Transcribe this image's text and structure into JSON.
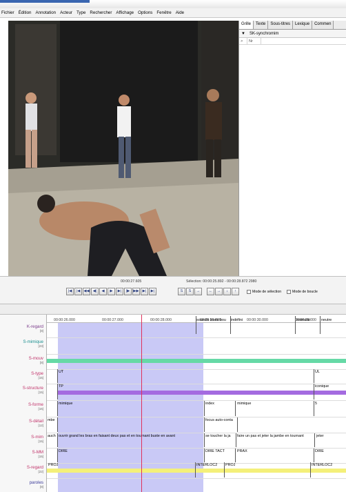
{
  "menu": [
    "Fichier",
    "Édition",
    "Annotation",
    "Acteur",
    "Type",
    "Rechercher",
    "Affichage",
    "Options",
    "Fenêtre",
    "Aide"
  ],
  "right_panel": {
    "tabs": [
      "Grille",
      "Texte",
      "Sous-titres",
      "Lexique",
      "Commen"
    ],
    "tier_dropdown": "SK-synchromim",
    "column_header": "Nr"
  },
  "controls": {
    "current_time": "00:00:27.605",
    "selection": "Sélection: 00:00:25.892 - 00:00:28.872 2980",
    "selection_mode": "Mode de sélection",
    "loop_mode": "Mode de boucle"
  },
  "timeline": {
    "ticks": [
      "00:00:26.000",
      "00:00:27.000",
      "00:00:28.000",
      "00:00:29.000",
      "00:00:30.000",
      "00:00:31.000"
    ]
  },
  "tiers": [
    {
      "name": "K-regard",
      "count": "[8]",
      "color": "#7a3a8a"
    },
    {
      "name": "S-mimique",
      "count": "[23]",
      "color": "#1a8f8f"
    },
    {
      "name": "S-mouv",
      "count": "[8]",
      "color": "#c0336a"
    },
    {
      "name": "S-type",
      "count": "[15]",
      "color": "#c0336a"
    },
    {
      "name": "S-structure",
      "count": "[15]",
      "color": "#c0336a"
    },
    {
      "name": "S-forme",
      "count": "[16]",
      "color": "#c0336a"
    },
    {
      "name": "S-détail",
      "count": "[12]",
      "color": "#c0336a"
    },
    {
      "name": "S-mim",
      "count": "[15]",
      "color": "#c0336a"
    },
    {
      "name": "S-MM",
      "count": "[15]",
      "color": "#c0336a"
    },
    {
      "name": "S-regard",
      "count": "[22]",
      "color": "#c0336a"
    },
    {
      "name": "paroles",
      "count": "[8]",
      "color": "#3a3a9a"
    }
  ],
  "annotations": {
    "mimique": [
      "sourcils levés bou",
      "indéfini",
      "intensité",
      "neutre"
    ],
    "type": [
      "UT",
      "UL"
    ],
    "structure": [
      "TP",
      "iconique"
    ],
    "forme": [
      "mimique",
      "index",
      "mimique",
      "5"
    ],
    "detail": [
      "mbe",
      "focus auto-conta"
    ],
    "mim": [
      "auch",
      "ouvrir grand les bras en faisant deux pas et en tournant buste en avant",
      "se toucher la ja",
      "faire un pas et jeter la jambe en tournant",
      "jeter"
    ],
    "mm": [
      "DIRE",
      "DIRE TACT",
      "PRAX",
      "DIRE"
    ],
    "regard": [
      "PROJ",
      "INTERLOC2",
      "PROJ",
      "INTERLOC2"
    ]
  },
  "colors": {
    "selection": "#c9c9f6",
    "cursor": "#e0305a",
    "mouv_bar": "#66d9a6",
    "structure_bar": "#a46be0",
    "regard_bar": "#f4f07a"
  }
}
